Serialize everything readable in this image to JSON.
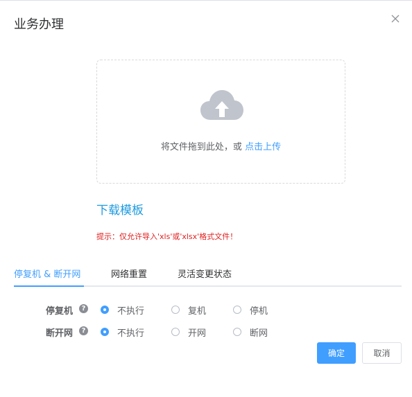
{
  "dialog": {
    "title": "业务办理",
    "close_icon": "close-icon"
  },
  "upload": {
    "icon": "cloud-upload-icon",
    "text_prefix": "将文件拖到此处，或 ",
    "link_text": "点击上传"
  },
  "download_template": "下载模板",
  "hint": "提示：仅允许导入'xls'或'xlsx'格式文件！",
  "tabs": [
    {
      "label": "停复机 & 断开网",
      "active": true
    },
    {
      "label": "网络重置",
      "active": false
    },
    {
      "label": "灵活变更状态",
      "active": false
    }
  ],
  "fields": [
    {
      "label": "停复机",
      "help_icon": "question-circle-icon",
      "options": [
        "不执行",
        "复机",
        "停机"
      ],
      "selected": "不执行"
    },
    {
      "label": "断开网",
      "help_icon": "question-circle-icon",
      "options": [
        "不执行",
        "开网",
        "断网"
      ],
      "selected": "不执行"
    }
  ],
  "buttons": {
    "confirm": "确定",
    "cancel": "取消"
  },
  "colors": {
    "primary": "#409eff",
    "link": "#1e9be0",
    "hint": "#e02020"
  }
}
